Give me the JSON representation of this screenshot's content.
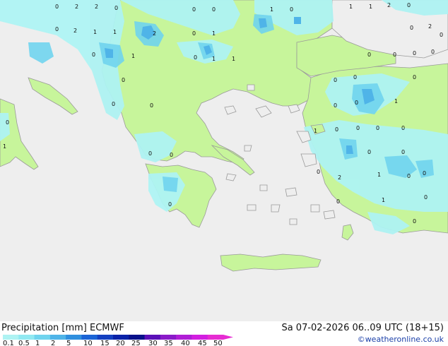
{
  "title": "Precipitation [mm]  ECMWF",
  "valid_time": "Sa 07-02-2026 06..09 UTC (18+15)",
  "credit": "©weatheronline.co.uk",
  "colors": {
    "sea": "#eeeeee",
    "land_dry": "#eeeeee",
    "land_light": "#c7f59b",
    "precip_0_1": "#aef3f3",
    "precip_0_5": "#91e9f2",
    "precip_1": "#70d4ee",
    "precip_2": "#4fb4e8",
    "coast": "#9a9a9a"
  },
  "legend": {
    "labels": [
      "0.1",
      "0.5",
      "1",
      "2",
      "5",
      "10",
      "15",
      "20",
      "25",
      "30",
      "35",
      "40",
      "45",
      "50"
    ],
    "colors": [
      "#aef3f3",
      "#91e9f2",
      "#70d4ee",
      "#4fb4e8",
      "#2f8fde",
      "#1b64d6",
      "#1440c0",
      "#0a22a8",
      "#08118a",
      "#5a10b8",
      "#8a1ac8",
      "#b01ed6",
      "#d21ee0",
      "#e62cd2"
    ]
  },
  "value_markers": [
    {
      "v": "2"
    },
    {
      "v": "2"
    },
    {
      "v": "0"
    },
    {
      "v": "0"
    },
    {
      "v": "0"
    },
    {
      "v": "0"
    },
    {
      "v": "1"
    },
    {
      "v": "0"
    },
    {
      "v": "1"
    },
    {
      "v": "1"
    },
    {
      "v": "2"
    },
    {
      "v": "0"
    },
    {
      "v": "0"
    },
    {
      "v": "2"
    },
    {
      "v": "1"
    },
    {
      "v": "1"
    },
    {
      "v": "2"
    },
    {
      "v": "0"
    },
    {
      "v": "1"
    },
    {
      "v": "0"
    },
    {
      "v": "2"
    },
    {
      "v": "0"
    },
    {
      "v": "0"
    },
    {
      "v": "1"
    },
    {
      "v": "0"
    },
    {
      "v": "1"
    },
    {
      "v": "1"
    },
    {
      "v": "0"
    },
    {
      "v": "0"
    },
    {
      "v": "0"
    },
    {
      "v": "0"
    },
    {
      "v": "0"
    },
    {
      "v": "0"
    },
    {
      "v": "0"
    },
    {
      "v": "0"
    },
    {
      "v": "0"
    },
    {
      "v": "0"
    },
    {
      "v": "0"
    },
    {
      "v": "1"
    },
    {
      "v": "0"
    },
    {
      "v": "1"
    },
    {
      "v": "0"
    },
    {
      "v": "0"
    },
    {
      "v": "0"
    },
    {
      "v": "0"
    },
    {
      "v": "1"
    },
    {
      "v": "0"
    },
    {
      "v": "0"
    },
    {
      "v": "0"
    },
    {
      "v": "0"
    },
    {
      "v": "2"
    },
    {
      "v": "0"
    },
    {
      "v": "0"
    },
    {
      "v": "0"
    },
    {
      "v": "1"
    },
    {
      "v": "0"
    },
    {
      "v": "0"
    },
    {
      "v": "0"
    },
    {
      "v": "0"
    },
    {
      "v": "1"
    },
    {
      "v": "0"
    }
  ]
}
